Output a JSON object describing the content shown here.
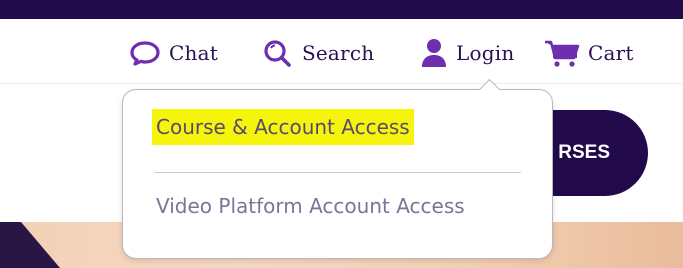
{
  "nav": {
    "chat": {
      "label": "Chat",
      "icon": "chat-bubble-icon"
    },
    "search": {
      "label": "Search",
      "icon": "magnifier-icon"
    },
    "login": {
      "label": "Login",
      "icon": "user-icon"
    },
    "cart": {
      "label": "Cart",
      "icon": "cart-icon"
    }
  },
  "courses_button": {
    "label": "RSES"
  },
  "login_dropdown": {
    "items": [
      {
        "label": "Course & Account Access",
        "highlighted": true
      },
      {
        "label": "Video Platform Account Access",
        "highlighted": false
      }
    ]
  },
  "colors": {
    "brand_dark": "#200a48",
    "icon_purple": "#6f2db0",
    "highlight": "#f5f50c",
    "link_muted": "#7d7496"
  }
}
